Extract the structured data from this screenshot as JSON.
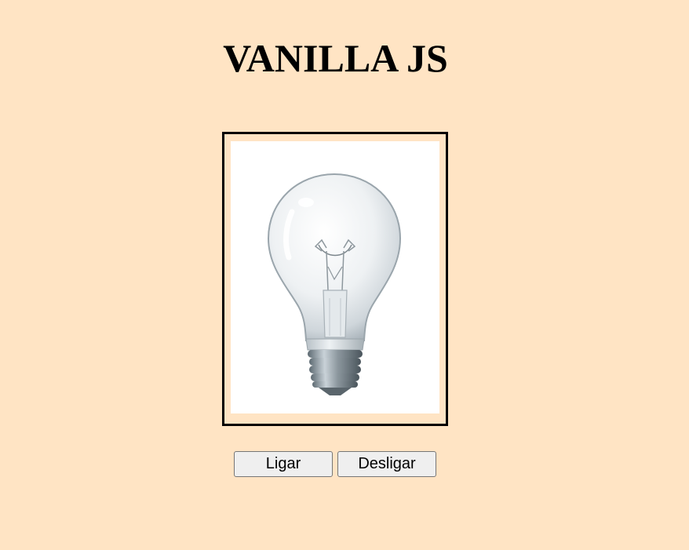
{
  "header": {
    "title": "VANILLA JS"
  },
  "lamp": {
    "image_icon": "light-bulb-off",
    "state": "off"
  },
  "controls": {
    "on_label": "Ligar",
    "off_label": "Desligar"
  },
  "colors": {
    "background": "#ffe4c4",
    "frame_border": "#000000",
    "button_background": "#efefef"
  }
}
